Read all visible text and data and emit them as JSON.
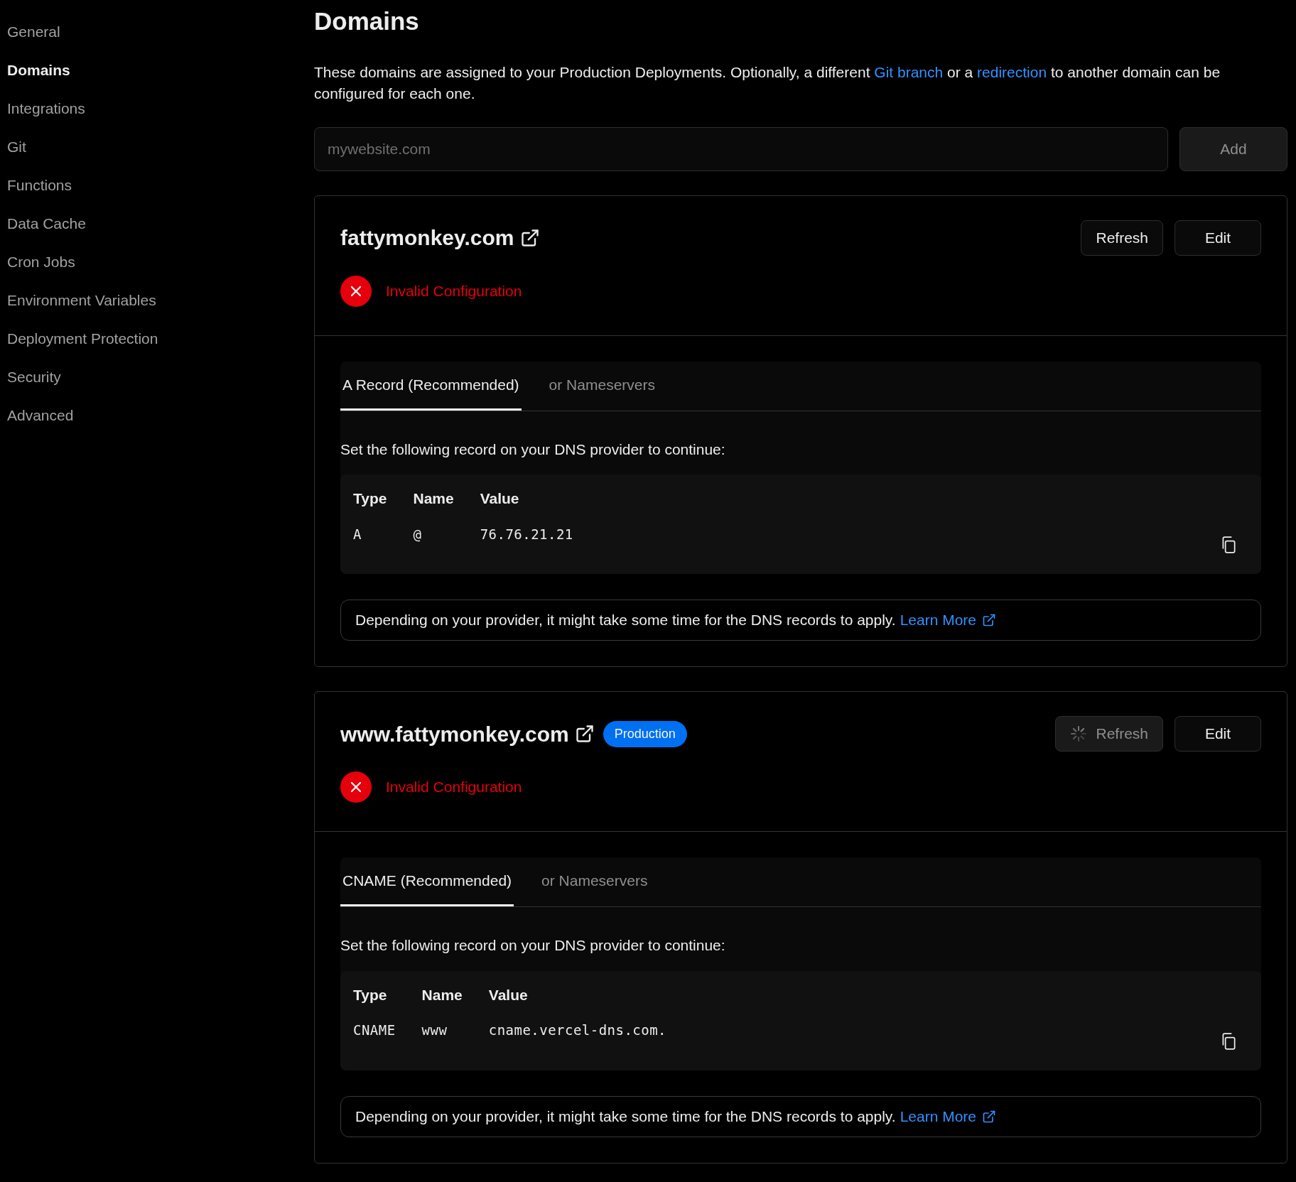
{
  "sidebar": {
    "items": [
      {
        "label": "General",
        "selected": false
      },
      {
        "label": "Domains",
        "selected": true
      },
      {
        "label": "Integrations",
        "selected": false
      },
      {
        "label": "Git",
        "selected": false
      },
      {
        "label": "Functions",
        "selected": false
      },
      {
        "label": "Data Cache",
        "selected": false
      },
      {
        "label": "Cron Jobs",
        "selected": false
      },
      {
        "label": "Environment Variables",
        "selected": false
      },
      {
        "label": "Deployment Protection",
        "selected": false
      },
      {
        "label": "Security",
        "selected": false
      },
      {
        "label": "Advanced",
        "selected": false
      }
    ]
  },
  "title": "Domains",
  "description": [
    {
      "kind": "text",
      "text": "These domains are assigned to your Production Deployments. Optionally, a different "
    },
    {
      "kind": "link",
      "text": "Git branch"
    },
    {
      "kind": "text",
      "text": " or a "
    },
    {
      "kind": "link",
      "text": "redirection"
    },
    {
      "kind": "text",
      "text": " to another domain can be configured for each one."
    }
  ],
  "add_domain": {
    "placeholder": "mywebsite.com",
    "button": "Add"
  },
  "domains": [
    {
      "name": "fattymonkey.com",
      "refresh": "Refresh",
      "refresh_loading": false,
      "edit": "Edit",
      "status": {
        "kind": "error",
        "text": "Invalid Configuration"
      },
      "tabs": [
        {
          "label": "A Record (Recommended)",
          "selected": true
        },
        {
          "label": "or Nameservers",
          "selected": false
        }
      ],
      "instruction": "Set the following record on your DNS provider to continue:",
      "columns": [
        "Type",
        "Name",
        "Value"
      ],
      "row": [
        "A",
        "@",
        "76.76.21.21"
      ],
      "note": "Depending on your provider, it might take some time for the DNS records to apply.",
      "note_link": "Learn More"
    },
    {
      "name": "www.fattymonkey.com",
      "badge": "Production",
      "refresh": "Refresh",
      "refresh_loading": true,
      "edit": "Edit",
      "status": {
        "kind": "error",
        "text": "Invalid Configuration"
      },
      "tabs": [
        {
          "label": "CNAME (Recommended)",
          "selected": true
        },
        {
          "label": "or Nameservers",
          "selected": false
        }
      ],
      "instruction": "Set the following record on your DNS provider to continue:",
      "columns": [
        "Type",
        "Name",
        "Value"
      ],
      "row": [
        "CNAME",
        "www",
        "cname.vercel-dns.com."
      ],
      "note": "Depending on your provider, it might take some time for the DNS records to apply.",
      "note_link": "Learn More"
    }
  ]
}
